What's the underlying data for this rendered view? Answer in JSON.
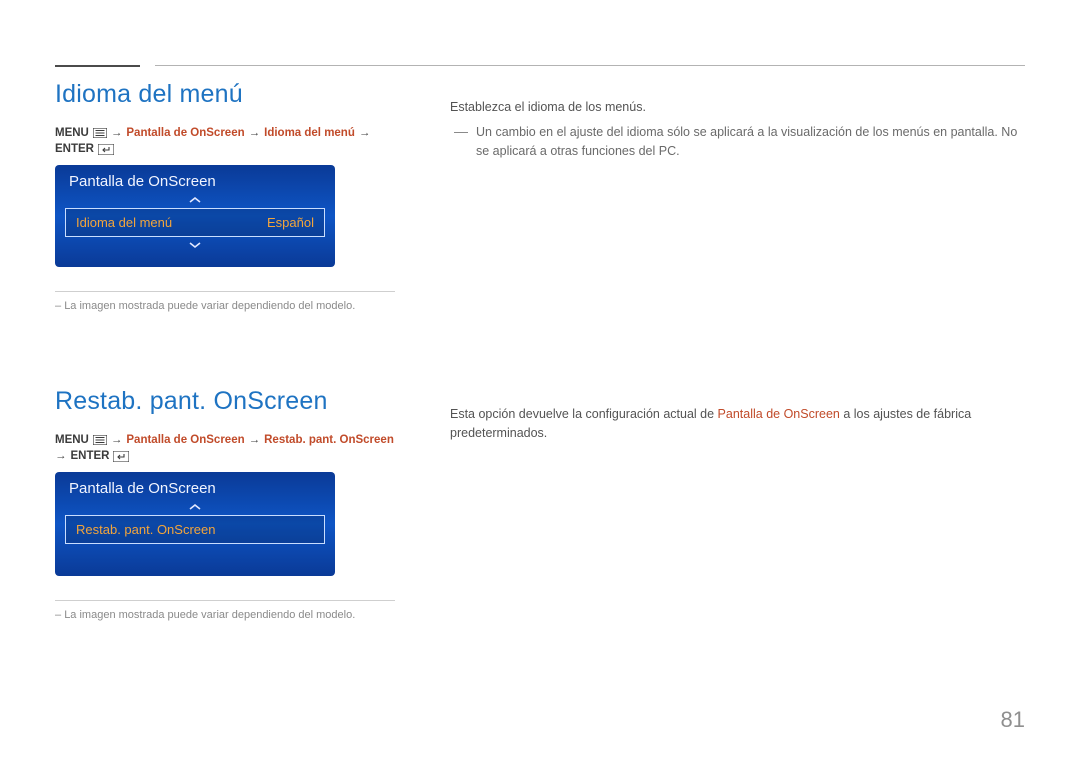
{
  "colors": {
    "accent": "#1e73c2",
    "link": "#c14b2a",
    "osd_value": "#f3a53b"
  },
  "page_number": "81",
  "section1": {
    "heading": "Idioma del menú",
    "breadcrumb": {
      "menu_word": "MENU",
      "pantalla": "Pantalla de OnScreen",
      "item": "Idioma del menú",
      "enter_word": "ENTER"
    },
    "osd": {
      "title": "Pantalla de OnScreen",
      "item_label": "Idioma del menú",
      "item_value": "Español"
    },
    "footnote": "La imagen mostrada puede variar dependiendo del modelo.",
    "desc_main": "Establezca el idioma de los menús.",
    "desc_note": "Un cambio en el ajuste del idioma sólo se aplicará a la visualización de los menús en pantalla. No se aplicará a otras funciones del PC."
  },
  "section2": {
    "heading": "Restab. pant. OnScreen",
    "breadcrumb": {
      "menu_word": "MENU",
      "pantalla": "Pantalla de OnScreen",
      "item": "Restab. pant. OnScreen",
      "enter_word": "ENTER"
    },
    "osd": {
      "title": "Pantalla de OnScreen",
      "item_label": "Restab. pant. OnScreen"
    },
    "footnote": "La imagen mostrada puede variar dependiendo del modelo.",
    "desc_pre": "Esta opción devuelve la configuración actual de ",
    "desc_link": "Pantalla de OnScreen",
    "desc_post": " a los ajustes de fábrica predeterminados."
  }
}
